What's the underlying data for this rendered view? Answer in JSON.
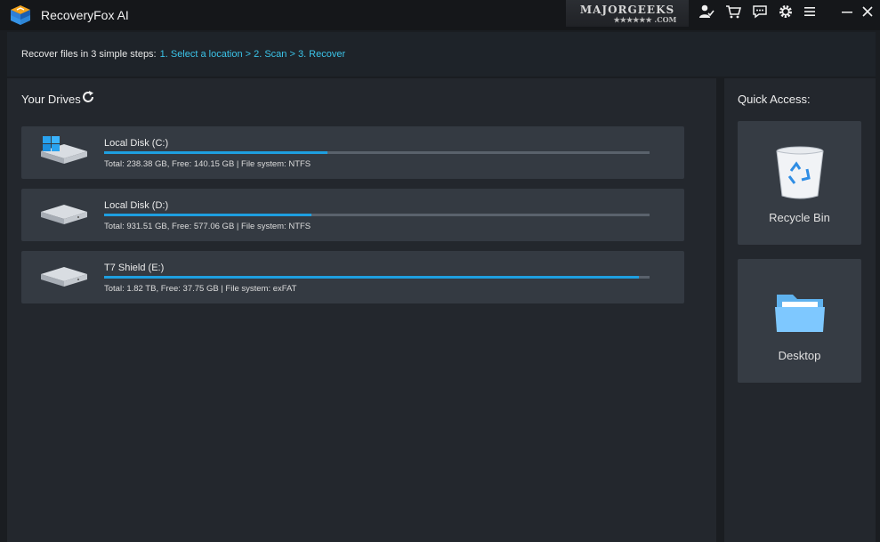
{
  "app": {
    "title": "RecoveryFox AI",
    "watermark_main": "MAJORGEEKS",
    "watermark_sub": "★★★★★★ .COM"
  },
  "toolbar": {
    "icons": [
      "account-icon",
      "cart-icon",
      "feedback-icon",
      "settings-icon",
      "menu-icon",
      "minimize-icon",
      "close-icon"
    ]
  },
  "steps": {
    "prefix": "Recover files in 3 simple steps:",
    "path": "1. Select a location > 2. Scan > 3. Recover"
  },
  "drives": {
    "title": "Your Drives",
    "items": [
      {
        "name": "Local Disk (C:)",
        "info": "Total: 238.38 GB, Free: 140.15 GB | File system: NTFS",
        "used_fraction": 0.41,
        "icon": "windows-drive-icon"
      },
      {
        "name": "Local Disk (D:)",
        "info": "Total: 931.51 GB, Free: 577.06 GB | File system: NTFS",
        "used_fraction": 0.38,
        "icon": "drive-icon"
      },
      {
        "name": "T7 Shield (E:)",
        "info": "Total: 1.82 TB, Free: 37.75 GB | File system: exFAT",
        "used_fraction": 0.98,
        "icon": "drive-icon"
      }
    ]
  },
  "quick_access": {
    "title": "Quick Access:",
    "items": [
      {
        "label": "Recycle Bin",
        "icon": "recycle-bin-icon"
      },
      {
        "label": "Desktop",
        "icon": "folder-icon"
      }
    ]
  },
  "colors": {
    "accent": "#3bc3e8",
    "bar_fill": "#1e9fe0",
    "panel": "#23272d",
    "card": "#343a42"
  }
}
